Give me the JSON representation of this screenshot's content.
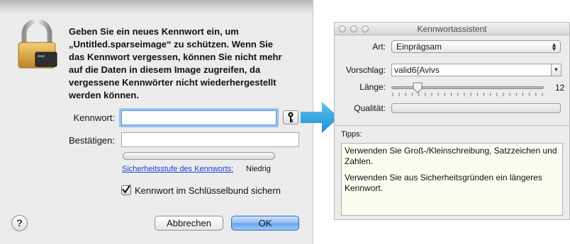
{
  "dialog": {
    "message": "Geben Sie ein neues Kennwort ein, um\n„Untitled.sparseimage“ zu schützen. Wenn Sie\ndas Kennwort vergessen, können Sie nicht mehr\nauf die Daten in diesem Image zugreifen, da\nvergessene Kennwörter nicht wiederhergestellt\nwerden können.",
    "password_label": "Kennwort:",
    "password_value": "",
    "confirm_label": "Bestätigen:",
    "confirm_value": "",
    "key_button_icon": "key-icon",
    "strength_link": "Sicherheitsstufe des Kennworts:",
    "strength_value": "Niedrig",
    "strength_level": 0,
    "keychain_checkbox_label": "Kennwort im Schlüsselbund sichern",
    "keychain_checked": true,
    "help_icon": "question-mark-icon",
    "help_label": "?",
    "cancel_label": "Abbrechen",
    "ok_label": "OK",
    "ok_color": "#6aa4ee"
  },
  "arrow": {
    "icon": "right-arrow-icon",
    "color": "#2aa3e0"
  },
  "assistant": {
    "title": "Kennwortassistent",
    "type_label": "Art:",
    "type_value": "Einprägsam",
    "suggestion_label": "Vorschlag:",
    "suggestion_value": "valid6{Avivs",
    "length_label": "Länge:",
    "length_value": "12",
    "length_min": 8,
    "length_max": 31,
    "quality_label": "Qualität:",
    "quality_level": 0,
    "tips_label": "Tipps:",
    "tips": [
      "Verwenden Sie Groß-/Kleinschreibung, Satzzeichen und Zahlen.",
      "Verwenden Sie aus Sicherheitsgründen ein längeres Kennwort."
    ]
  }
}
